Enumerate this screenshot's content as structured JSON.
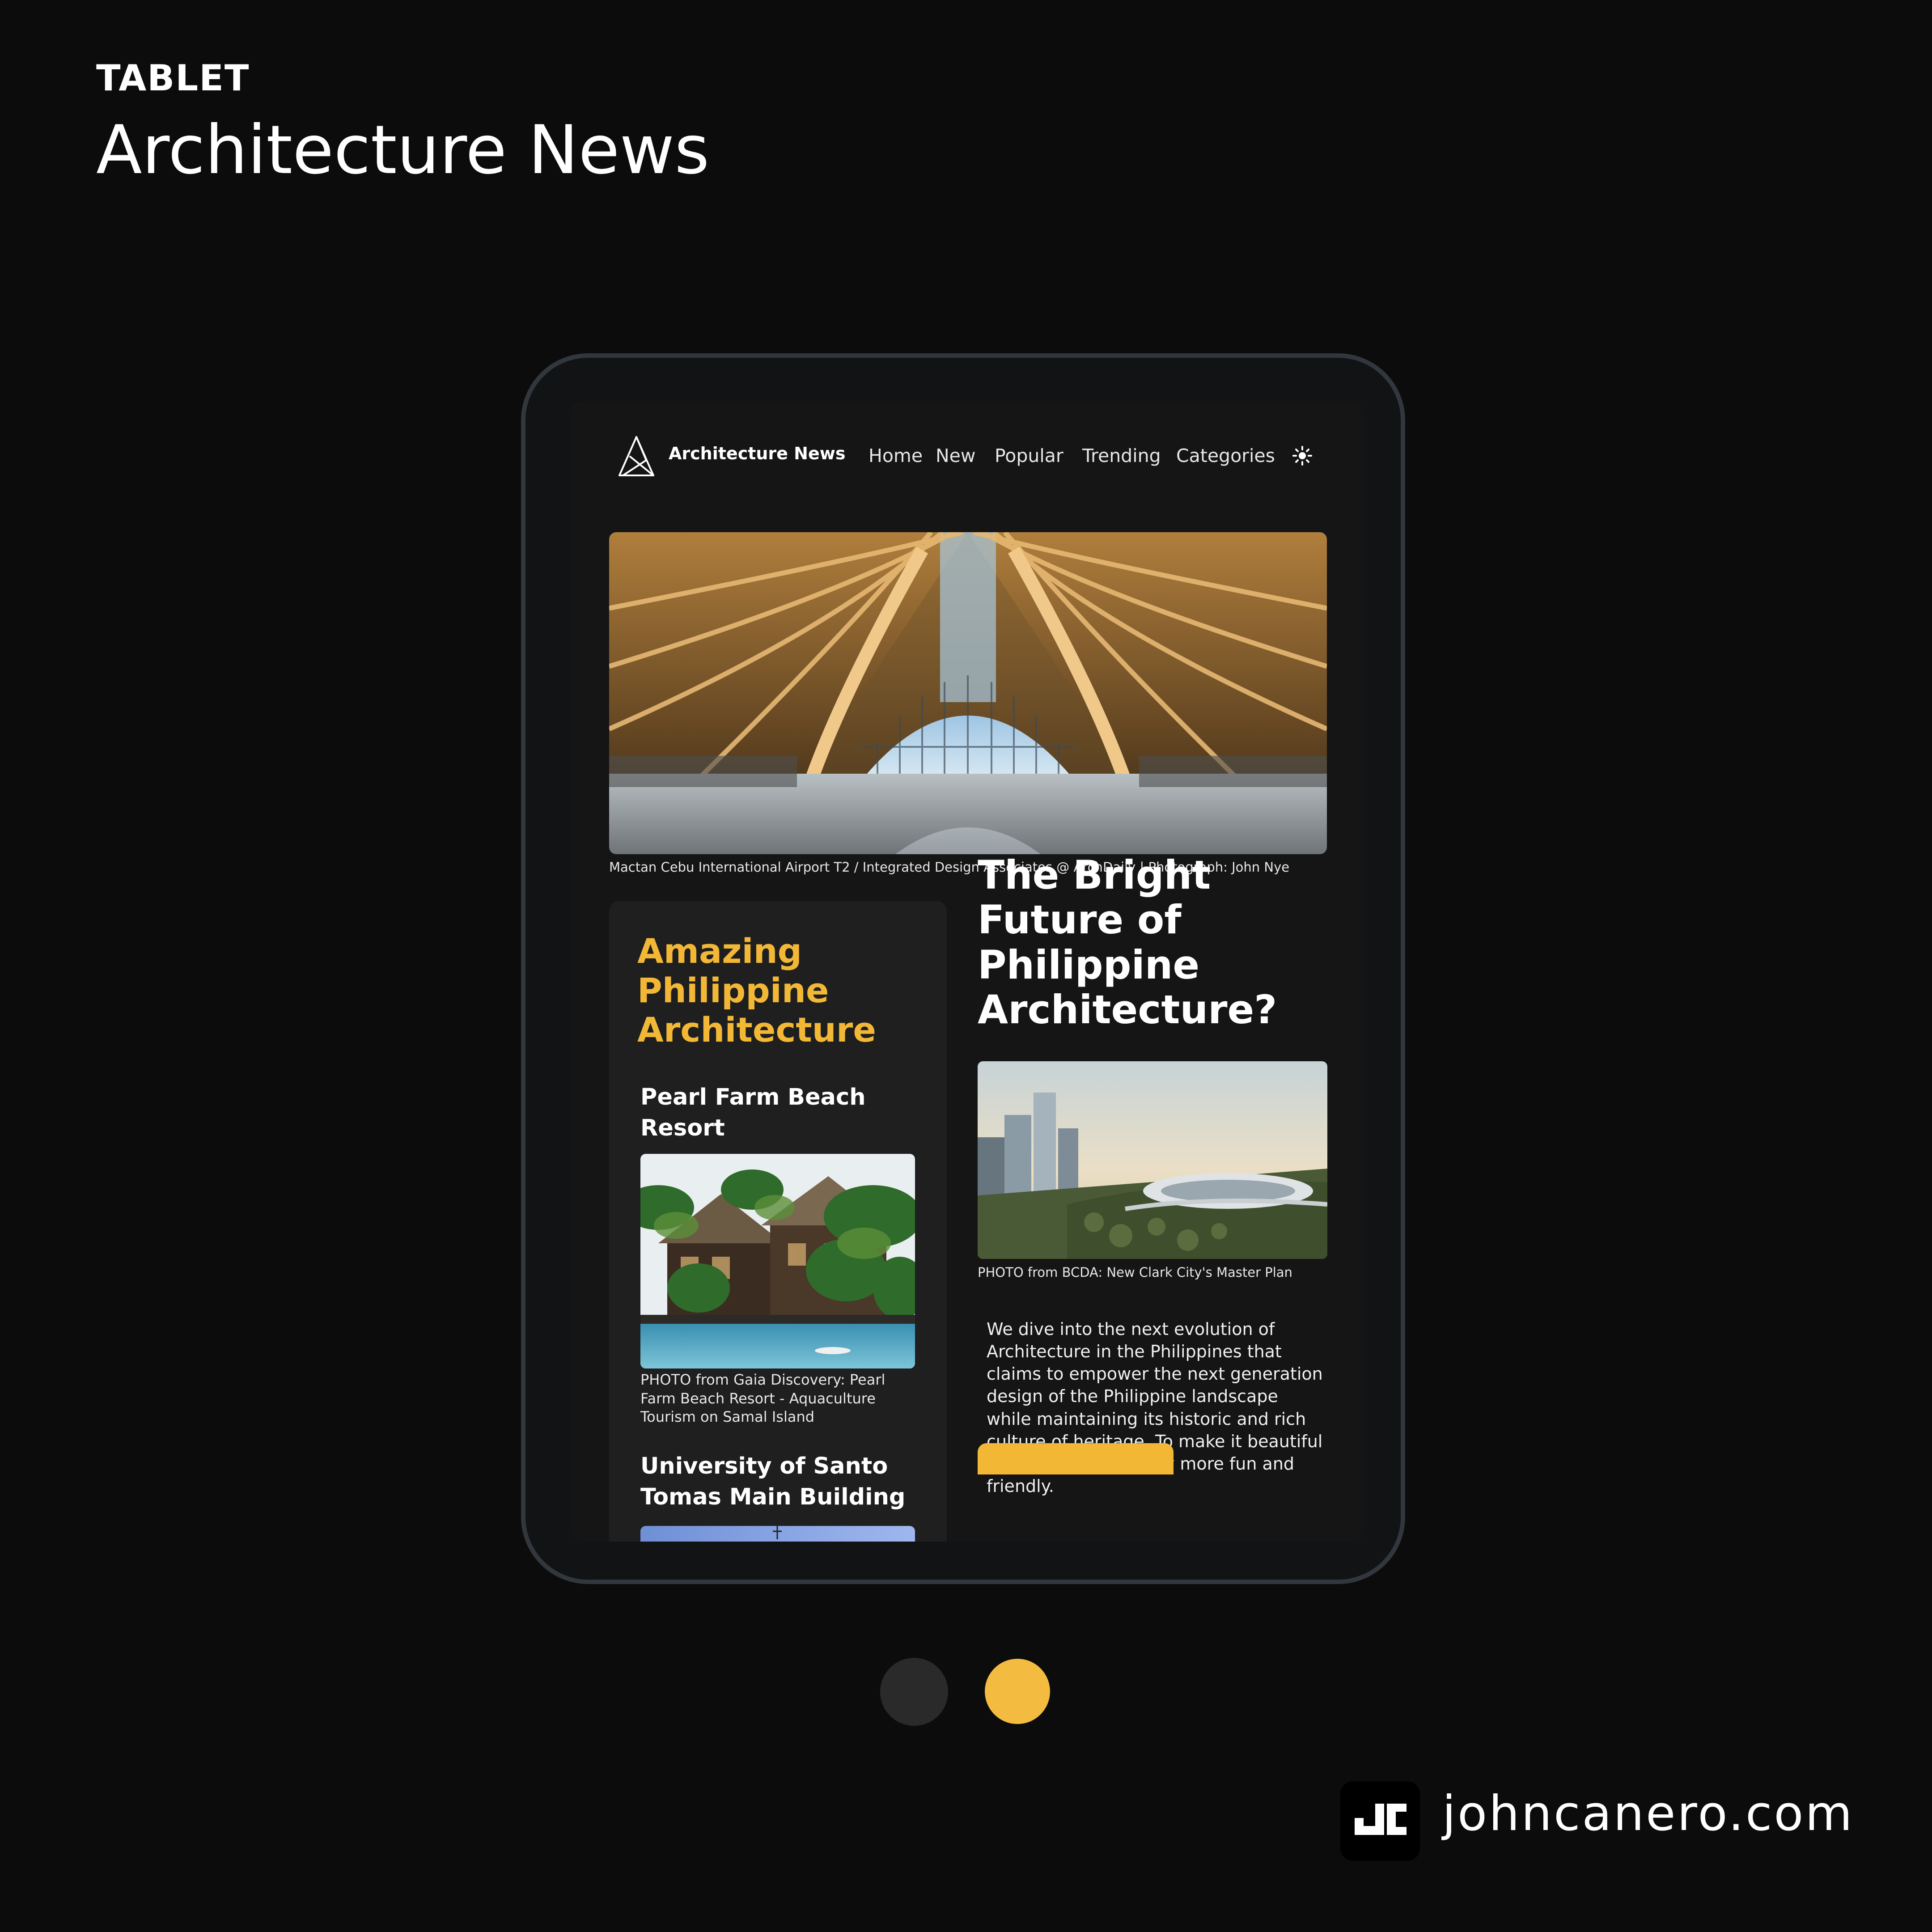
{
  "page": {
    "eyebrow": "TABLET",
    "headline": "Architecture News",
    "site_url": "johncanero.com"
  },
  "nav": {
    "brand": "Architecture News",
    "links": [
      "Home",
      "New",
      "Popular",
      "Trending",
      "Categories"
    ],
    "theme_icon": "sun-icon"
  },
  "hero": {
    "caption": "Mactan Cebu International Airport T2 / Integrated Design Associates @ ArchDaily | Photograph: John Nye"
  },
  "sidebar": {
    "title": "Amazing Philippine Architecture",
    "items": [
      {
        "title": "Pearl Farm Beach Resort",
        "caption": "PHOTO from Gaia Discovery: Pearl Farm Beach Resort - Aquaculture Tourism on Samal Island"
      },
      {
        "title": "University of Santo Tomas Main Building"
      }
    ]
  },
  "feature": {
    "title": "The Bright Future of Philippine Architecture?",
    "caption": "PHOTO from BCDA: New Clark City's Master Plan",
    "body": "We dive into the next evolution of Architecture in the Philippines that claims to empower the next generation design of the Philippine landscape while maintaining its historic and rich culture of heritage. To make it beautiful and make our country more fun and friendly."
  },
  "carousel": {
    "total": 2,
    "active_index": 1
  },
  "colors": {
    "accent": "#f2b835",
    "background": "#0c0c0c",
    "screen": "#151516",
    "panel": "#1f1f20",
    "device_frame": "#31373c"
  }
}
